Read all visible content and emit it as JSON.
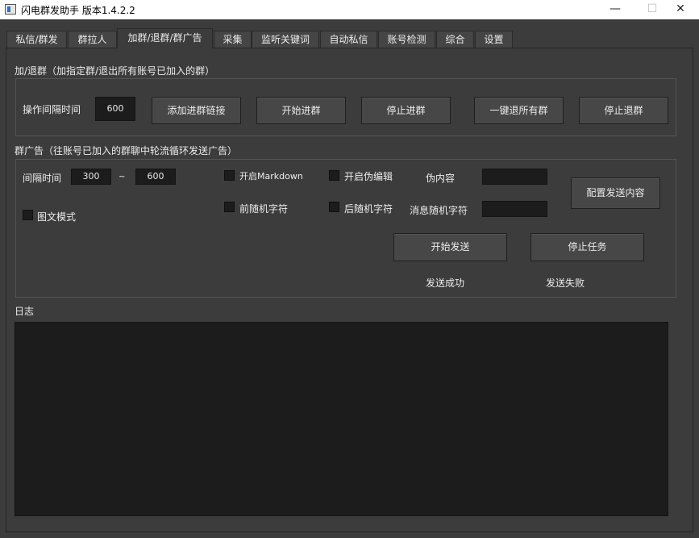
{
  "window": {
    "title": "闪电群发助手  版本1.4.2.2",
    "minimize": "—",
    "maximize": "☐",
    "close": "✕"
  },
  "tabs": [
    {
      "label": "私信/群发"
    },
    {
      "label": "群拉人"
    },
    {
      "label": "加群/退群/群广告"
    },
    {
      "label": "采集"
    },
    {
      "label": "监听关键词"
    },
    {
      "label": "自动私信"
    },
    {
      "label": "账号检测"
    },
    {
      "label": "综合"
    },
    {
      "label": "设置"
    }
  ],
  "active_tab": "加群/退群/群广告",
  "join_group": {
    "title": "加/退群（加指定群/退出所有账号已加入的群）",
    "interval_label": "操作间隔时间",
    "interval_value": "600",
    "add_link_button": "添加进群链接",
    "start_join_button": "开始进群",
    "stop_join_button": "停止进群",
    "leave_all_button": "一键退所有群",
    "stop_leave_button": "停止退群"
  },
  "group_ad": {
    "title": "群广告（往账号已加入的群聊中轮流循环发送广告）",
    "interval_label": "间隔时间",
    "interval_min": "300",
    "range_sep": "~",
    "interval_max": "600",
    "markdown_label": "开启Markdown",
    "fake_edit_label": "开启伪编辑",
    "fake_content_label": "伪内容",
    "fake_content_value": "",
    "config_button": "配置发送内容",
    "image_text_label": "图文模式",
    "prefix_random_label": "前随机字符",
    "suffix_random_label": "后随机字符",
    "msg_random_label": "消息随机字符",
    "msg_random_value": "",
    "start_send_button": "开始发送",
    "stop_task_button": "停止任务",
    "success_label": "发送成功",
    "fail_label": "发送失败"
  },
  "log": {
    "title": "日志",
    "content": ""
  }
}
